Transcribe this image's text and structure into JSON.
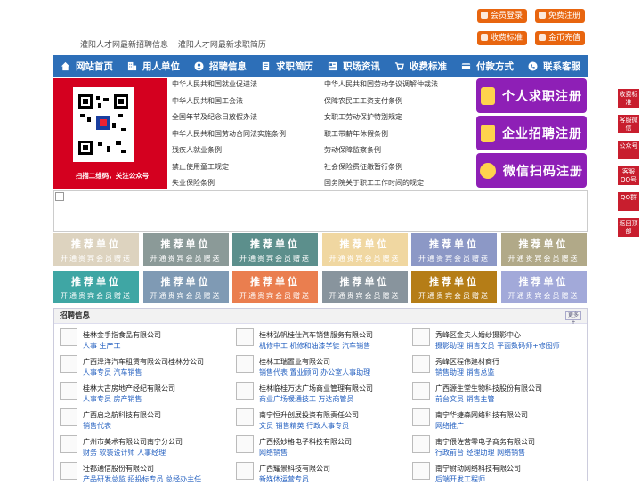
{
  "top_buttons": {
    "member_login": "会员登录",
    "free_register": "免费注册",
    "fee_standard": "收费标准",
    "coin_recharge": "金币充值"
  },
  "top_links": [
    "灌阳人才网最新招聘信息",
    "灌阳人才网最新求职简历"
  ],
  "nav": [
    {
      "label": "网站首页",
      "icon": "home-icon"
    },
    {
      "label": "用人单位",
      "icon": "building-icon"
    },
    {
      "label": "招聘信息",
      "icon": "people-icon"
    },
    {
      "label": "求职简历",
      "icon": "resume-icon"
    },
    {
      "label": "职场资讯",
      "icon": "news-icon"
    },
    {
      "label": "收费标准",
      "icon": "cart-icon"
    },
    {
      "label": "付款方式",
      "icon": "payment-icon"
    },
    {
      "label": "联系客服",
      "icon": "phone-icon"
    }
  ],
  "qr": {
    "caption": "扫描二维码，关注公众号"
  },
  "laws_left": [
    "中华人民共和国就业促进法",
    "中华人民共和国工会法",
    "全国年节及纪念日放假办法",
    "中华人民共和国劳动合同法实施条例",
    "残疾人就业条例",
    "禁止使用童工规定",
    "失业保险条例"
  ],
  "laws_right": [
    "中华人民共和国劳动争议调解仲裁法",
    "保障农民工工资支付条例",
    "女职工劳动保护特别规定",
    "职工带薪年休假条例",
    "劳动保障监察条例",
    "社会保险费征缴暂行条例",
    "国务院关于职工工作时间的规定"
  ],
  "register": {
    "personal": "个人求职注册",
    "company": "企业招聘注册",
    "wechat": "微信扫码注册"
  },
  "tiles": {
    "title": "推荐单位",
    "subtitle": "开通贵宾会员赠送",
    "colors": [
      "#ddd3bf",
      "#8b9a98",
      "#5c8f8c",
      "#f0d7a1",
      "#8c98c6",
      "#b1a988",
      "#3fa6a4",
      "#7f9ab4",
      "#ea7e4f",
      "#88949d",
      "#b57d17",
      "#a2a9d9"
    ]
  },
  "jobs": {
    "header": "招聘信息",
    "more": "更多+",
    "items": [
      {
        "company": "桂林金手指食品有限公司",
        "positions": "人事 生产工"
      },
      {
        "company": "桂林弘帆桂仕汽车销售服务有限公司",
        "positions": "机修中工 机修和油漆学徒 汽车销售"
      },
      {
        "company": "秀峰区金夫人婚纱摄影中心",
        "positions": "摄影助理 销售文员 平面数码师+修图师"
      },
      {
        "company": "广西泽洋汽车租赁有限公司桂林分公司",
        "positions": "人事专员 汽车销售"
      },
      {
        "company": "桂林工瑞置业有限公司",
        "positions": "销售代表 置业顾问 办公室人事助理"
      },
      {
        "company": "秀峰区程伟建材商行",
        "positions": "销售助理 销售总监"
      },
      {
        "company": "桂林大古房地产经纪有限公司",
        "positions": "人事专员 房产销售"
      },
      {
        "company": "桂林临桂万达广场商业管理有限公司",
        "positions": "商业广场暖通技工 万达商管员"
      },
      {
        "company": "广西源生堂生物科技股份有限公司",
        "positions": "前台文员 销售主管"
      },
      {
        "company": "广西启之航科技有限公司",
        "positions": "销售代表"
      },
      {
        "company": "南宁恒升创展投资有限责任公司",
        "positions": "文员 销售精英 行政人事专员"
      },
      {
        "company": "南宁华捷森网络科技有限公司",
        "positions": "网络推广"
      },
      {
        "company": "广州市美术有限公司南宁分公司",
        "positions": "财务 软装设计师 人事经理"
      },
      {
        "company": "广西扬妙格电子科技有限公司",
        "positions": "网络销售"
      },
      {
        "company": "南宁偎佐营零电子商务有限公司",
        "positions": "行政前台 经理助理 网络销售"
      },
      {
        "company": "壮都通信股份有限公司",
        "positions": "产品研发总监 招投标专员 总经办主任"
      },
      {
        "company": "广西耀景科技有限公司",
        "positions": "新媒体运营专员"
      },
      {
        "company": "南宁尉动网络科技有限公司",
        "positions": "后端开发工程师"
      }
    ]
  },
  "side": [
    "收费标准",
    "客服微信",
    "公众号",
    "客服QQ号",
    "QQ群",
    "返回顶部"
  ]
}
